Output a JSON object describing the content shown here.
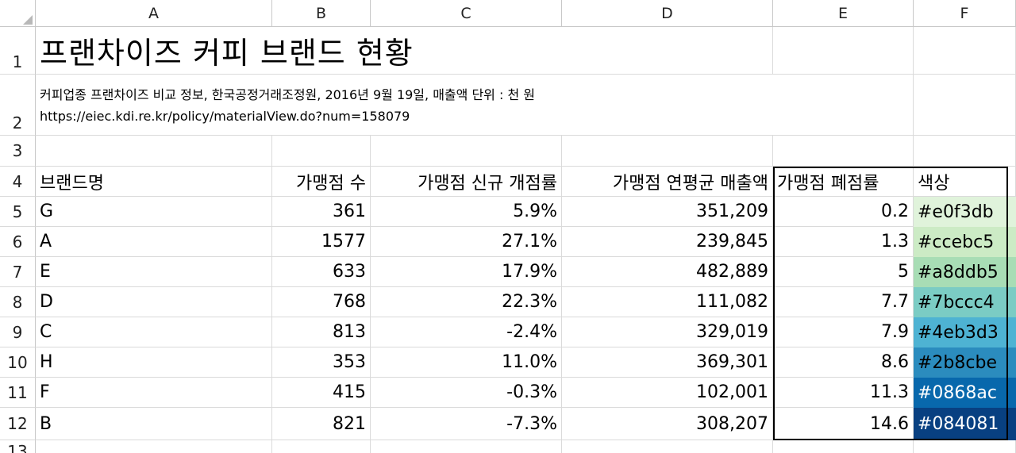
{
  "columns": [
    "A",
    "B",
    "C",
    "D",
    "E",
    "F"
  ],
  "rows": [
    "1",
    "2",
    "3",
    "4",
    "5",
    "6",
    "7",
    "8",
    "9",
    "10",
    "11",
    "12",
    "13"
  ],
  "title": "프랜차이즈 커피 브랜드 현황",
  "subtitle_line1": "커피업종 프랜차이즈 비교 정보, 한국공정거래조정원, 2016년 9월 19일, 매출액 단위 : 천 원",
  "subtitle_line2": "https://eiec.kdi.re.kr/policy/materialView.do?num=158079",
  "headers": {
    "brand": "브랜드명",
    "stores": "가맹점 수",
    "new_rate": "가맹점 신규 개점률",
    "avg_sales": "가맹점 연평균 매출액",
    "close_rate": "가맹점 폐점률",
    "color": "색상"
  },
  "table": [
    {
      "brand": "G",
      "stores": "361",
      "new_rate": "5.9%",
      "avg_sales": "351,209",
      "close_rate": "0.2",
      "color": "#e0f3db",
      "fill": "#e0f3db",
      "text_color": "#000000"
    },
    {
      "brand": "A",
      "stores": "1577",
      "new_rate": "27.1%",
      "avg_sales": "239,845",
      "close_rate": "1.3",
      "color": "#ccebc5",
      "fill": "#ccebc5",
      "text_color": "#000000"
    },
    {
      "brand": "E",
      "stores": "633",
      "new_rate": "17.9%",
      "avg_sales": "482,889",
      "close_rate": "5",
      "color": "#a8ddb5",
      "fill": "#a8ddb5",
      "text_color": "#000000"
    },
    {
      "brand": "D",
      "stores": "768",
      "new_rate": "22.3%",
      "avg_sales": "111,082",
      "close_rate": "7.7",
      "color": "#7bccc4",
      "fill": "#7bccc4",
      "text_color": "#000000"
    },
    {
      "brand": "C",
      "stores": "813",
      "new_rate": "-2.4%",
      "avg_sales": "329,019",
      "close_rate": "7.9",
      "color": "#4eb3d3",
      "fill": "#4eb3d3",
      "text_color": "#000000"
    },
    {
      "brand": "H",
      "stores": "353",
      "new_rate": "11.0%",
      "avg_sales": "369,301",
      "close_rate": "8.6",
      "color": "#2b8cbe",
      "fill": "#2b8cbe",
      "text_color": "#000000"
    },
    {
      "brand": "F",
      "stores": "415",
      "new_rate": "-0.3%",
      "avg_sales": "102,001",
      "close_rate": "11.3",
      "color": "#0868ac",
      "fill": "#0868ac",
      "text_color": "#ffffff"
    },
    {
      "brand": "B",
      "stores": "821",
      "new_rate": "-7.3%",
      "avg_sales": "308,207",
      "close_rate": "14.6",
      "color": "#084081",
      "fill": "#084081",
      "text_color": "#ffffff"
    }
  ]
}
